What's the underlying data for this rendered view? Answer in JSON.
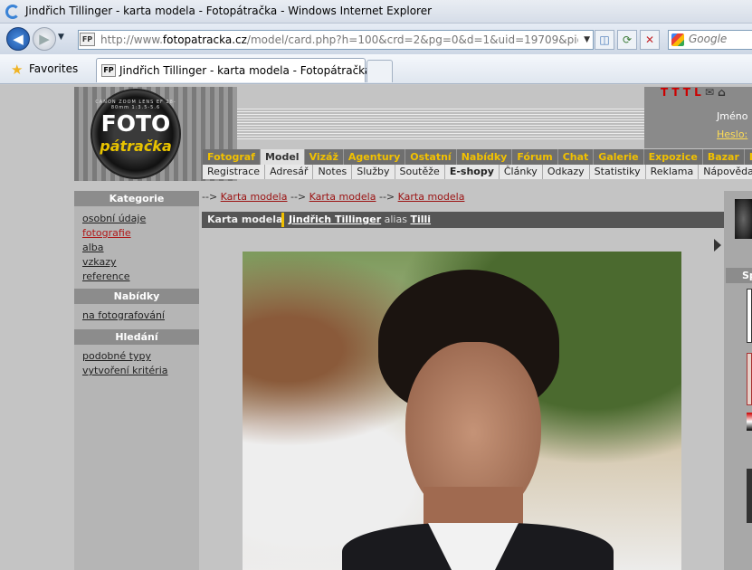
{
  "window": {
    "title": "Jindřich Tillinger - karta modela - Fotopátračka - Windows Internet Explorer"
  },
  "address": {
    "favicon": "FP",
    "prefix": "http://www.",
    "domain": "fotopatracka.cz",
    "path": "/model/card.php?h=100&crd=2&pg=0&d=1&uid=19709&pid=689517"
  },
  "search": {
    "placeholder": "Google"
  },
  "favorites": {
    "label": "Favorites"
  },
  "tab": {
    "favicon": "FP",
    "label": "Jindřich Tillinger - karta modela - Fotopátračka"
  },
  "logo": {
    "top": "FOTO",
    "bottom": "pátračka",
    "ring": "CANON ZOOM LENS EF 28-80mm 1:3.5-5.6"
  },
  "header": {
    "ttl": "T T T L",
    "login_name": "Jméno",
    "login_pass": "Heslo:"
  },
  "menu_main": [
    "Fotograf",
    "Model",
    "Vizáž",
    "Agentury",
    "Ostatní",
    "Nabídky",
    "Fórum",
    "Chat",
    "Galerie",
    "Expozice",
    "Bazar",
    "Lokace"
  ],
  "menu_main_active": "Model",
  "menu_sub": [
    "Registrace",
    "Adresář",
    "Notes",
    "Služby",
    "Soutěže",
    "E-shopy",
    "Články",
    "Odkazy",
    "Statistiky",
    "Reklama",
    "Nápověda"
  ],
  "menu_sub_bold": "E-shopy",
  "sidebar": {
    "kategorie": "Kategorie",
    "links": [
      "osobní údaje",
      "fotografie",
      "alba",
      "vzkazy",
      "reference"
    ],
    "current": "fotografie",
    "nabidky": "Nabídky",
    "nabidky_links": [
      "na fotografování"
    ],
    "hledani": "Hledání",
    "hledani_links": [
      "podobné typy",
      "vytvoření kritéria"
    ]
  },
  "breadcrumb": {
    "sep": "-->",
    "items": [
      "Karta modela",
      "Karta modela",
      "Karta modela"
    ]
  },
  "card": {
    "label": "Karta modela",
    "name": "Jindřich Tillinger",
    "alias_word": "alias",
    "alias": "Tilli"
  },
  "right": {
    "head": "Sp"
  }
}
